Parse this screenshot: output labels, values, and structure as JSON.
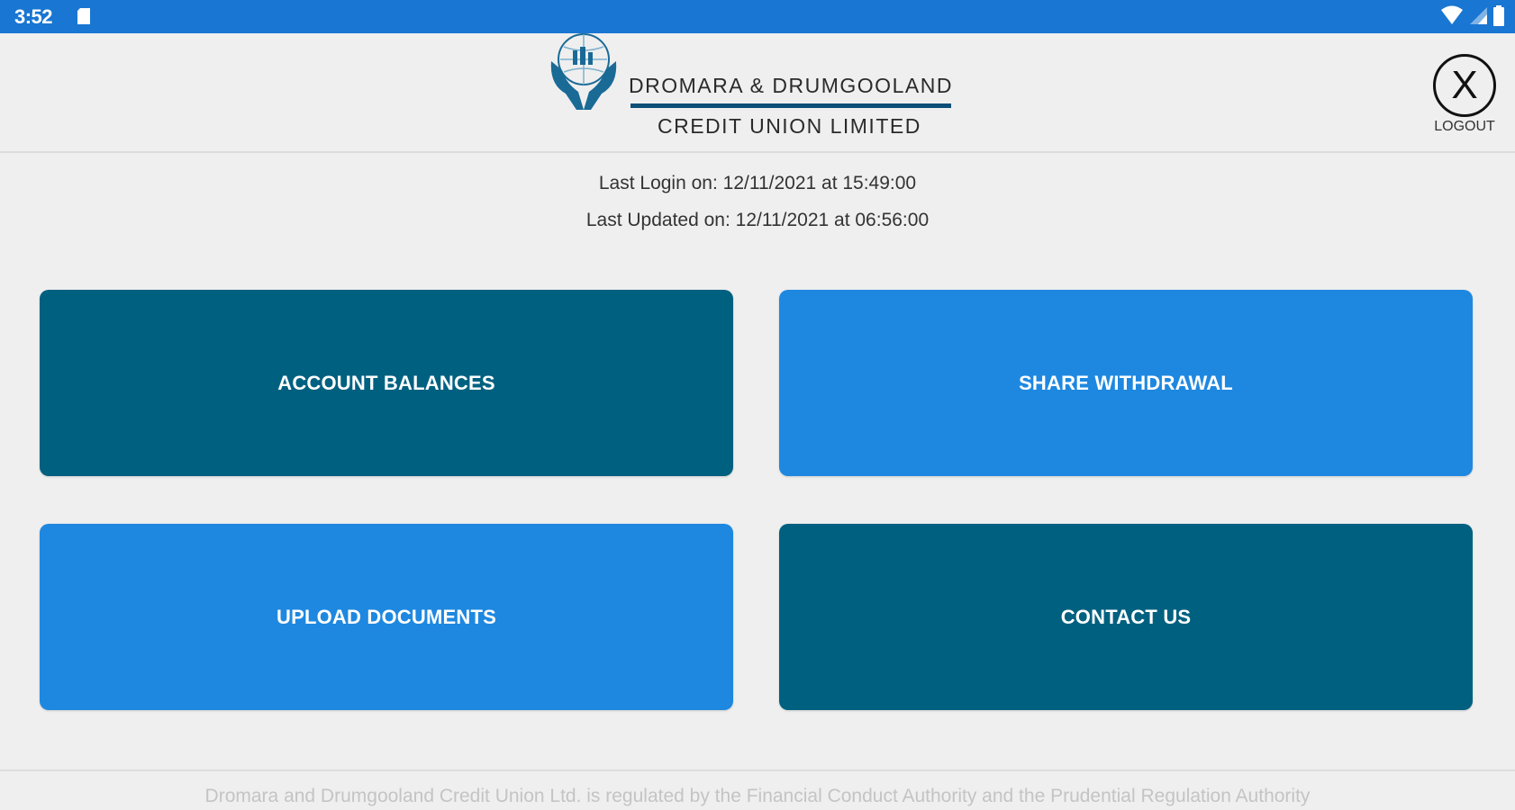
{
  "status_bar": {
    "time": "3:52",
    "color": "#1976d2",
    "icons": [
      "sd-card-icon",
      "wifi-icon",
      "signal-icon",
      "battery-icon"
    ]
  },
  "header": {
    "logo": {
      "line1": "DROMARA & DRUMGOOLAND",
      "line2": "CREDIT UNION LIMITED",
      "emblem_color": "#1a6a96"
    },
    "logout": {
      "symbol": "X",
      "label": "LOGOUT"
    }
  },
  "info": {
    "last_login_label": "Last Login on:",
    "last_login_value": "12/11/2021 at 15:49:00",
    "last_updated_label": "Last Updated on:",
    "last_updated_value": "12/11/2021 at 06:56:00"
  },
  "tiles": [
    {
      "label": "ACCOUNT BALANCES",
      "color": "#006080"
    },
    {
      "label": "SHARE WITHDRAWAL",
      "color": "#1e88e0"
    },
    {
      "label": "UPLOAD DOCUMENTS",
      "color": "#1e88e0"
    },
    {
      "label": "CONTACT US",
      "color": "#006080"
    }
  ],
  "footer": {
    "text": "Dromara and Drumgooland Credit Union Ltd. is regulated by the Financial Conduct Authority and the Prudential Regulation Authority"
  }
}
